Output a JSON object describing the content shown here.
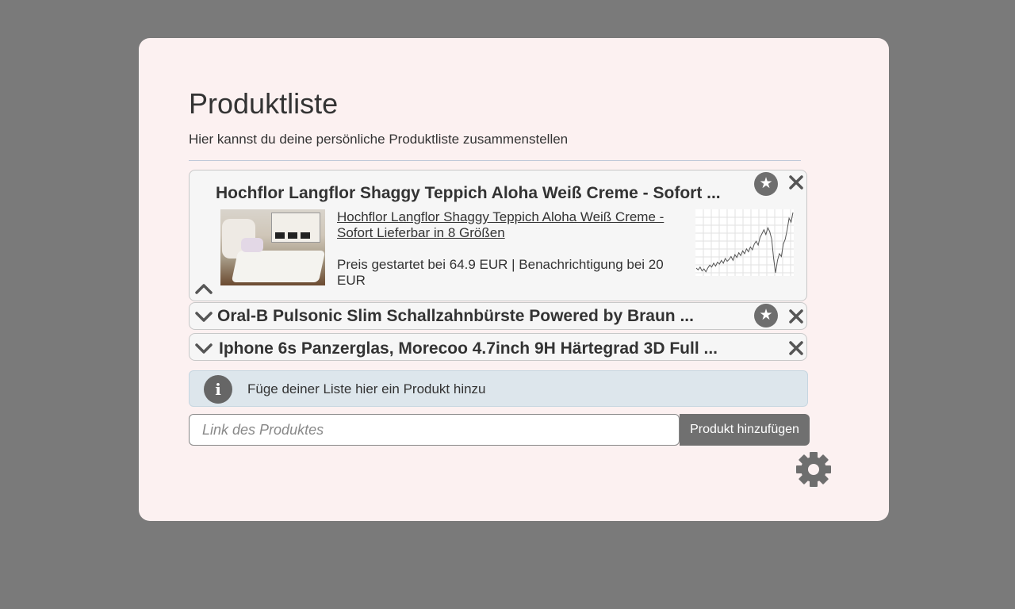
{
  "header": {
    "title": "Produktliste",
    "subtitle": "Hier kannst du deine persönliche Produktliste zusammenstellen"
  },
  "products": [
    {
      "title": "Hochflor Langflor Shaggy Teppich Aloha Weiß Creme - Sofort ...",
      "link_text": "Hochflor Langflor Shaggy Teppich Aloha Weiß Creme - Sofort Lieferbar in 8 Größen",
      "price_text": "Preis gestartet bei 64.9 EUR | Benachrichtigung bei 20 EUR",
      "expanded": true,
      "starred": true,
      "price_history": [
        30,
        28,
        31,
        27,
        29,
        26,
        30,
        33,
        31,
        35,
        32,
        36,
        34,
        38,
        35,
        40,
        37,
        39,
        42,
        38,
        44,
        41,
        46,
        43,
        48,
        45,
        50,
        47,
        52,
        49,
        55,
        58,
        54,
        62,
        66,
        70,
        65,
        72,
        68,
        60,
        40,
        25,
        38,
        45,
        42,
        55,
        60,
        70,
        82,
        78,
        88
      ]
    },
    {
      "title": "Oral-B Pulsonic Slim Schallzahnbürste Powered by Braun ...",
      "expanded": false,
      "starred": true
    },
    {
      "title": "Iphone 6s Panzerglas, Morecoo 4.7inch 9H Härtegrad 3D Full ...",
      "expanded": false,
      "starred": false
    }
  ],
  "alert": {
    "text": "Füge deiner Liste hier ein Produkt hinzu",
    "icon": "info-icon"
  },
  "add_form": {
    "placeholder": "Link des Produktes",
    "value": "",
    "button_label": "Produkt hinzufügen"
  },
  "icons": {
    "star": "star-icon",
    "close": "close-icon",
    "collapse": "chevron-up-icon",
    "expand": "chevron-down-icon",
    "settings": "gear-icon"
  },
  "colors": {
    "background": "#7a7a7a",
    "card": "#fcf1f1",
    "button": "#707070",
    "alert": "#dde6ec"
  }
}
